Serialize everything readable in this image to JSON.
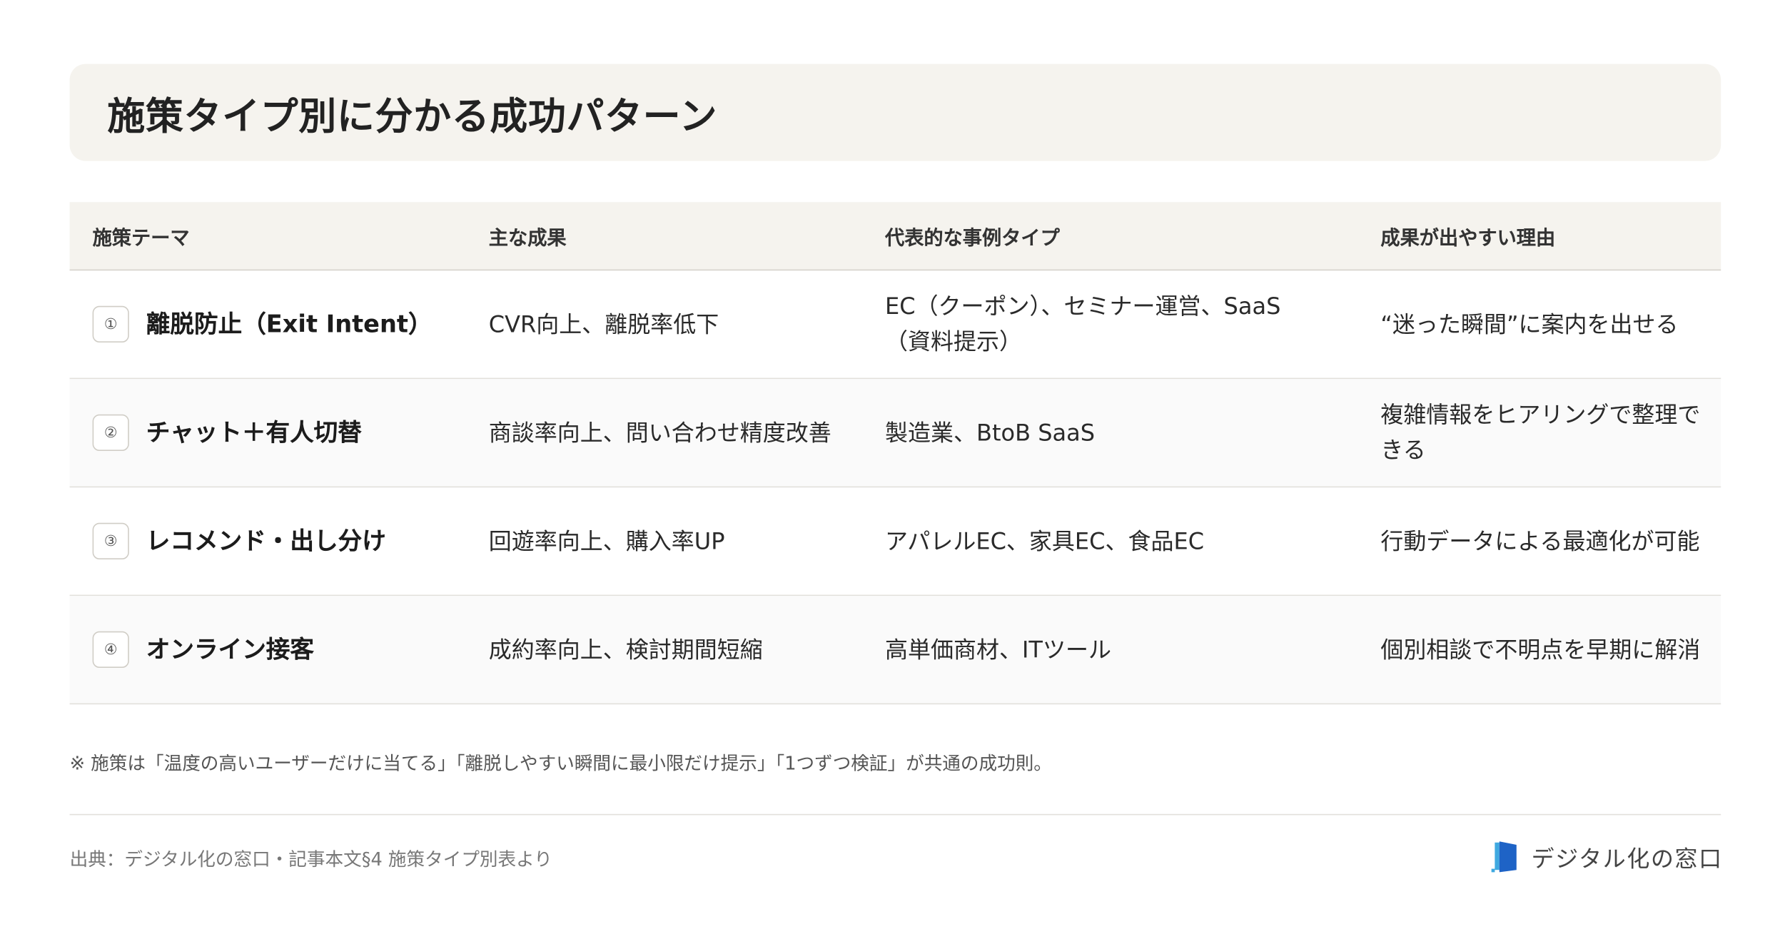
{
  "title": "施策タイプ別に分かる成功パターン",
  "table": {
    "headers": [
      "施策テーマ",
      "主な成果",
      "代表的な事例タイプ",
      "成果が出やすい理由"
    ],
    "rows": [
      {
        "num": "①",
        "theme": "離脱防止（Exit Intent）",
        "result": "CVR向上、離脱率低下",
        "cases": "EC（クーポン）、セミナー運営、SaaS（資料提示）",
        "reason": "“迷った瞬間”に案内を出せる"
      },
      {
        "num": "②",
        "theme": "チャット＋有人切替",
        "result": "商談率向上、問い合わせ精度改善",
        "cases": "製造業、BtoB SaaS",
        "reason": "複雑情報をヒアリングで整理できる"
      },
      {
        "num": "③",
        "theme": "レコメンド・出し分け",
        "result": "回遊率向上、購入率UP",
        "cases": "アパレルEC、家具EC、食品EC",
        "reason": "行動データによる最適化が可能"
      },
      {
        "num": "④",
        "theme": "オンライン接客",
        "result": "成約率向上、検討期間短縮",
        "cases": "高単価商材、ITツール",
        "reason": "個別相談で不明点を早期に解消"
      }
    ]
  },
  "note": "※ 施策は「温度の高いユーザーだけに当てる」「離脱しやすい瞬間に最小限だけ提示」「1つずつ検証」が共通の成功則。",
  "source": "出典：デジタル化の窓口・記事本文§4 施策タイプ別表より",
  "brand": {
    "name": "デジタル化の窓口",
    "colors": {
      "primary": "#1e63c6",
      "accent": "#3fa9e0"
    },
    "icon": "door-logo-icon"
  }
}
